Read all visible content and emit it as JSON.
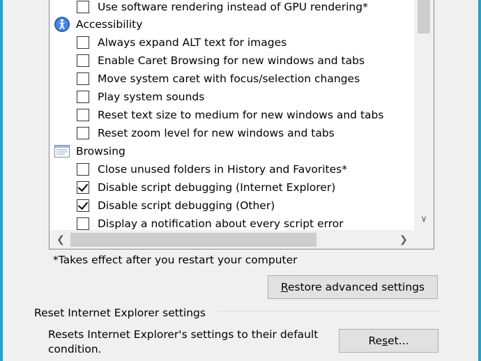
{
  "listbox": {
    "rows": [
      {
        "type": "item",
        "label": "Use software rendering instead of GPU rendering*",
        "checked": false
      },
      {
        "type": "category",
        "label": "Accessibility",
        "icon": "accessibility-icon"
      },
      {
        "type": "item",
        "label": "Always expand ALT text for images",
        "checked": false
      },
      {
        "type": "item",
        "label": "Enable Caret Browsing for new windows and tabs",
        "checked": false
      },
      {
        "type": "item",
        "label": "Move system caret with focus/selection changes",
        "checked": false
      },
      {
        "type": "item",
        "label": "Play system sounds",
        "checked": false
      },
      {
        "type": "item",
        "label": "Reset text size to medium for new windows and tabs",
        "checked": false
      },
      {
        "type": "item",
        "label": "Reset zoom level for new windows and tabs",
        "checked": false
      },
      {
        "type": "category",
        "label": "Browsing",
        "icon": "browsing-icon"
      },
      {
        "type": "item",
        "label": "Close unused folders in History and Favorites*",
        "checked": false
      },
      {
        "type": "item",
        "label": "Disable script debugging (Internet Explorer)",
        "checked": true
      },
      {
        "type": "item",
        "label": "Disable script debugging (Other)",
        "checked": true
      },
      {
        "type": "item",
        "label": "Display a notification about every script error",
        "checked": false
      }
    ]
  },
  "note": "*Takes effect after you restart your computer",
  "restore_button": {
    "label": "Restore advanced settings",
    "access_key": "R"
  },
  "reset_group": {
    "title": "Reset Internet Explorer settings",
    "description": "Resets Internet Explorer's settings to their default condition.",
    "reset_button": {
      "label": "Reset...",
      "access_key": "s"
    }
  },
  "colors": {
    "window_frame": "#27a2c8",
    "dialog_bg": "#f0f0f0",
    "button_bg": "#e1e1e1"
  }
}
